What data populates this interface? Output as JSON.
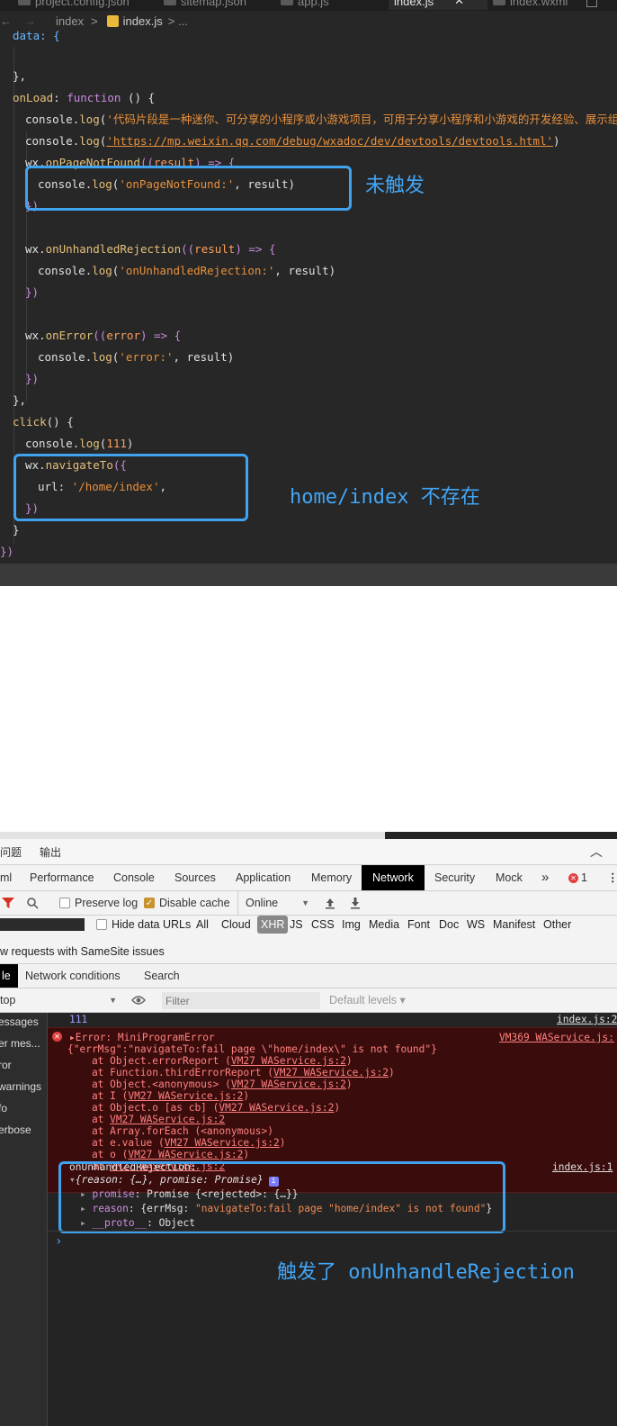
{
  "editor_tabs": [
    {
      "label": "project.config.json"
    },
    {
      "label": "sitemap.json"
    },
    {
      "label": "app.js"
    },
    {
      "label": "index.js",
      "close": "✕",
      "active": true
    },
    {
      "label": "index.wxml"
    }
  ],
  "breadcrumb": {
    "back": "←",
    "forward": "→",
    "folder": "index",
    "sep": ">",
    "file": "index.js",
    "more": "> ..."
  },
  "code": {
    "l0": "data: {",
    "l2": "},",
    "l3_a": "onLoad",
    "l3_b": ": ",
    "l3_c": "function",
    "l3_d": " () {",
    "l4_a": "console",
    "l4_b": ".",
    "l4_c": "log",
    "l4_d": "(",
    "l4_e": "'代码片段是一种迷你、可分享的小程序或小游戏项目，可用于分享小程序和小游戏的开发经验、展示组件和",
    "l5_e": "'https://mp.weixin.qq.com/debug/wxadoc/dev/devtools/devtools.html'",
    "l5_f": ")",
    "l6_a": "wx",
    "l6_c": "onPageNotFound",
    "l6_d": "((",
    "l6_e": "result",
    "l6_f": ") => {",
    "l7_e": "'onPageNotFound:'",
    "l7_f": ", result)",
    "l8": "})",
    "l10_c": "onUnhandledRejection",
    "l11_e": "'onUnhandledRejection:'",
    "l14_c": "onError",
    "l14_e": "error",
    "l15_e": "'error:'",
    "l17": "},",
    "l18_a": "click",
    "l18_b": "() {",
    "l19_e": "111",
    "l20_c": "navigateTo",
    "l20_d": "({",
    "l21_a": "url",
    "l21_b": ": ",
    "l21_e": "'/home/index'",
    "l21_f": ",",
    "l22": "})",
    "l23": "}",
    "l24": "})"
  },
  "annotations": {
    "not_triggered": "未触发",
    "not_exist": "home/index 不存在",
    "triggered": "触发了 onUnhandleRejection"
  },
  "drawer": {
    "problems": "问题",
    "output": "输出",
    "collapse": "︿"
  },
  "devtools_tabs": [
    "ml",
    "Performance",
    "Console",
    "Sources",
    "Application",
    "Memory",
    "Network",
    "Security",
    "Mock"
  ],
  "devtools_active": "Network",
  "devtools_more": "»",
  "error_count": "1",
  "error_icon": "✕",
  "kebab": "⋮",
  "network_toolbar": {
    "preserve_log": "Preserve log",
    "disable_cache": "Disable cache",
    "throttle": "Online",
    "check": "✓"
  },
  "filter_types": [
    "All",
    "Cloud",
    "XHR",
    "JS",
    "CSS",
    "Img",
    "Media",
    "Font",
    "Doc",
    "WS",
    "Manifest",
    "Other"
  ],
  "hide_data_urls": "Hide data URLs",
  "samesite_text": "w requests with SameSite issues",
  "drawer_tabs": {
    "console": "le",
    "network_conditions": "Network conditions",
    "search": "Search"
  },
  "console_toolbar": {
    "context": "top",
    "filter_placeholder": "Filter",
    "levels": "Default levels ▾"
  },
  "sidebar": [
    "essages",
    "er mes...",
    "ror",
    "warnings",
    "fo",
    "erbose"
  ],
  "console_lines": {
    "log111": "111",
    "log111_src": "index.js:2",
    "err_title": "Error: MiniProgramError",
    "err_src": "VM369 WAService.js:",
    "err_msg": "{\"errMsg\":\"navigateTo:fail page \\\"home/index\\\" is not found\"}",
    "stack": [
      {
        "pre": "    at Object.errorReport (",
        "link": "VM27 WAService.js:2",
        "post": ")"
      },
      {
        "pre": "    at Function.thirdErrorReport (",
        "link": "VM27 WAService.js:2",
        "post": ")"
      },
      {
        "pre": "    at Object.<anonymous> (",
        "link": "VM27 WAService.js:2",
        "post": ")"
      },
      {
        "pre": "    at I (",
        "link": "VM27 WAService.js:2",
        "post": ")"
      },
      {
        "pre": "    at Object.o [as cb] (",
        "link": "VM27 WAService.js:2",
        "post": ")"
      },
      {
        "pre": "    at ",
        "link": "VM27 WAService.js:2",
        "post": ""
      },
      {
        "pre": "    at Array.forEach (<anonymous>)",
        "link": "",
        "post": ""
      },
      {
        "pre": "    at e.value (",
        "link": "VM27 WAService.js:2",
        "post": ")"
      },
      {
        "pre": "    at o (",
        "link": "VM27 WAService.js:2",
        "post": ")"
      },
      {
        "pre": "    at ",
        "link": "VM27 WAService.js:2",
        "post": ""
      }
    ],
    "unh_title": "onUnhandledRejection:",
    "unh_src": "index.js:1",
    "unh_obj": "{reason: {…}, promise: Promise}",
    "promise_key": "promise",
    "promise_val": ": Promise {<rejected>: {…}}",
    "reason_key": "reason",
    "reason_val_pre": ": {errMsg: ",
    "reason_val_str": "\"navigateTo:fail page \"home/index\" is not found\"",
    "reason_val_post": "}",
    "proto_key": "__proto__",
    "proto_val": ": Object",
    "prompt": "›"
  }
}
